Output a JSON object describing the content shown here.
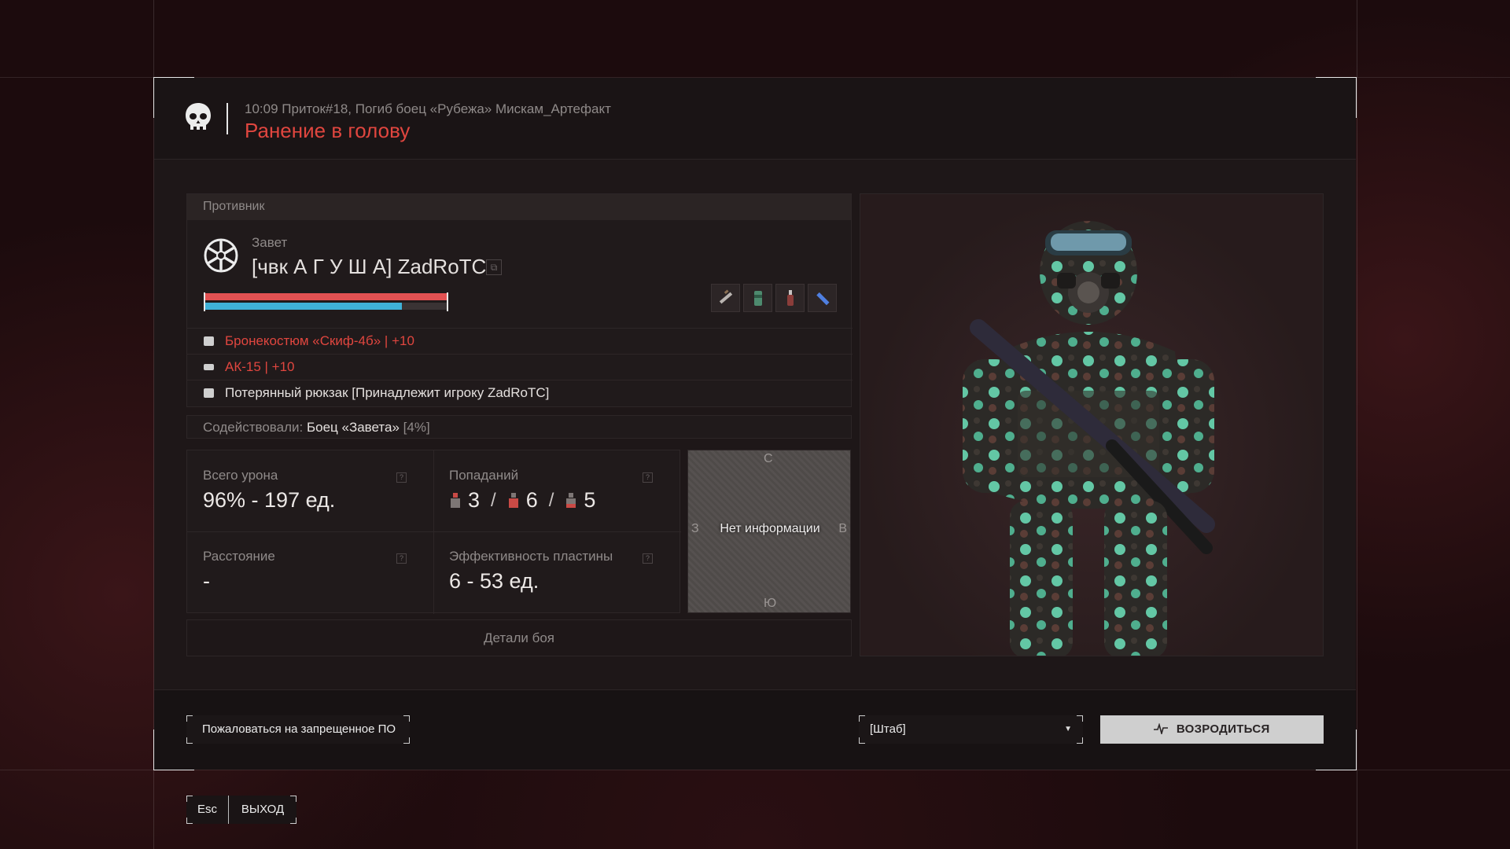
{
  "header": {
    "meta": "10:09 Приток#18, Погиб боец «Рубежа» Мискам_Артефакт",
    "title": "Ранение в голову"
  },
  "enemy": {
    "section_label": "Противник",
    "faction": "Завет",
    "nickname": "[чвк А Г У Ш А] ZadRoTC",
    "health_fraction": 1.0,
    "armor_fraction": 0.81,
    "quick_items": [
      "syringe-icon",
      "canister-icon",
      "bottle-icon",
      "flashlight-icon"
    ],
    "equipment": [
      {
        "icon": "armor-icon",
        "text": "Бронекостюм «Скиф-4б» | +10",
        "color": "#e0463f"
      },
      {
        "icon": "rifle-icon",
        "text": "АК-15 | +10",
        "color": "#e0463f"
      },
      {
        "icon": "backpack-icon",
        "text": "Потерянный рюкзак [Принадлежит игроку ZadRoTC]",
        "color": "#e4e0de"
      }
    ]
  },
  "assist": {
    "label": "Содействовали:",
    "name": "Боец «Завета»",
    "percent": "[4%]"
  },
  "stats": {
    "total_damage_label": "Всего урона",
    "total_damage_value": "96% - 197 ед.",
    "hits_label": "Попаданий",
    "hits_head": "3",
    "hits_body": "6",
    "hits_legs": "5",
    "hits_sep": "/",
    "distance_label": "Расстояние",
    "distance_value": "-",
    "plate_label": "Эффективность пластины",
    "plate_value": "6 - 53 ед.",
    "help_glyph": "?"
  },
  "map": {
    "north": "С",
    "south": "Ю",
    "west": "З",
    "east": "В",
    "no_data": "Нет информации"
  },
  "details_button": "Детали боя",
  "footer": {
    "report_button": "Пожаловаться на запрещенное ПО",
    "spawn_select": "[Штаб]",
    "respawn_button": "ВОЗРОДИТЬСЯ"
  },
  "exit": {
    "key": "Esc",
    "label": "ВЫХОД"
  },
  "colors": {
    "accent_red": "#e0463f",
    "health_bar": "#e25152",
    "armor_bar": "#3fb1d8"
  }
}
